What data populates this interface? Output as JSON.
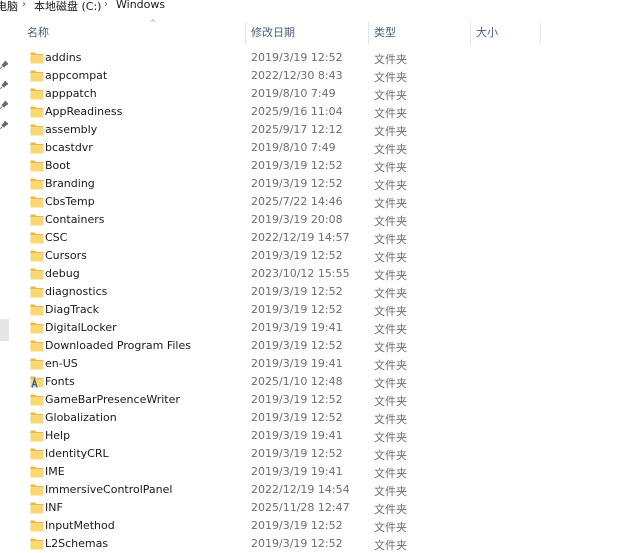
{
  "address_bar": {
    "segments": [
      "电脑",
      "本地磁盘 (C:)",
      "Windows"
    ],
    "separator": "›"
  },
  "columns": {
    "name": "名称",
    "date": "修改日期",
    "type": "类型",
    "size": "大小"
  },
  "colors": {
    "folder_yellow": "#f8d775",
    "folder_tab": "#e8b84a",
    "header_text": "#4c607a"
  },
  "rows": [
    {
      "name": "addins",
      "date": "2019/3/19 12:52",
      "type": "文件夹",
      "icon": "folder-icon"
    },
    {
      "name": "appcompat",
      "date": "2022/12/30 8:43",
      "type": "文件夹",
      "icon": "folder-icon"
    },
    {
      "name": "apppatch",
      "date": "2019/8/10 7:49",
      "type": "文件夹",
      "icon": "folder-icon"
    },
    {
      "name": "AppReadiness",
      "date": "2025/9/16 11:04",
      "type": "文件夹",
      "icon": "folder-icon"
    },
    {
      "name": "assembly",
      "date": "2025/9/17 12:12",
      "type": "文件夹",
      "icon": "folder-icon"
    },
    {
      "name": "bcastdvr",
      "date": "2019/8/10 7:49",
      "type": "文件夹",
      "icon": "folder-icon"
    },
    {
      "name": "Boot",
      "date": "2019/3/19 12:52",
      "type": "文件夹",
      "icon": "folder-icon"
    },
    {
      "name": "Branding",
      "date": "2019/3/19 12:52",
      "type": "文件夹",
      "icon": "folder-icon"
    },
    {
      "name": "CbsTemp",
      "date": "2025/7/22 14:46",
      "type": "文件夹",
      "icon": "folder-icon"
    },
    {
      "name": "Containers",
      "date": "2019/3/19 20:08",
      "type": "文件夹",
      "icon": "folder-icon"
    },
    {
      "name": "CSC",
      "date": "2022/12/19 14:57",
      "type": "文件夹",
      "icon": "folder-icon"
    },
    {
      "name": "Cursors",
      "date": "2019/3/19 12:52",
      "type": "文件夹",
      "icon": "folder-icon"
    },
    {
      "name": "debug",
      "date": "2023/10/12 15:55",
      "type": "文件夹",
      "icon": "folder-icon"
    },
    {
      "name": "diagnostics",
      "date": "2019/3/19 12:52",
      "type": "文件夹",
      "icon": "folder-icon"
    },
    {
      "name": "DiagTrack",
      "date": "2019/3/19 12:52",
      "type": "文件夹",
      "icon": "folder-icon"
    },
    {
      "name": "DigitalLocker",
      "date": "2019/3/19 19:41",
      "type": "文件夹",
      "icon": "folder-icon"
    },
    {
      "name": "Downloaded Program Files",
      "date": "2019/3/19 12:52",
      "type": "文件夹",
      "icon": "folder-icon"
    },
    {
      "name": "en-US",
      "date": "2019/3/19 19:41",
      "type": "文件夹",
      "icon": "folder-icon"
    },
    {
      "name": "Fonts",
      "date": "2025/1/10 12:48",
      "type": "文件夹",
      "icon": "fonts-folder-icon"
    },
    {
      "name": "GameBarPresenceWriter",
      "date": "2019/3/19 12:52",
      "type": "文件夹",
      "icon": "folder-icon"
    },
    {
      "name": "Globalization",
      "date": "2019/3/19 12:52",
      "type": "文件夹",
      "icon": "folder-icon"
    },
    {
      "name": "Help",
      "date": "2019/3/19 19:41",
      "type": "文件夹",
      "icon": "folder-icon"
    },
    {
      "name": "IdentityCRL",
      "date": "2019/3/19 12:52",
      "type": "文件夹",
      "icon": "folder-icon"
    },
    {
      "name": "IME",
      "date": "2019/3/19 19:41",
      "type": "文件夹",
      "icon": "folder-icon"
    },
    {
      "name": "ImmersiveControlPanel",
      "date": "2022/12/19 14:54",
      "type": "文件夹",
      "icon": "folder-icon"
    },
    {
      "name": "INF",
      "date": "2025/11/28 12:47",
      "type": "文件夹",
      "icon": "folder-icon"
    },
    {
      "name": "InputMethod",
      "date": "2019/3/19 12:52",
      "type": "文件夹",
      "icon": "folder-icon"
    },
    {
      "name": "L2Schemas",
      "date": "2019/3/19 12:52",
      "type": "文件夹",
      "icon": "folder-icon"
    }
  ]
}
